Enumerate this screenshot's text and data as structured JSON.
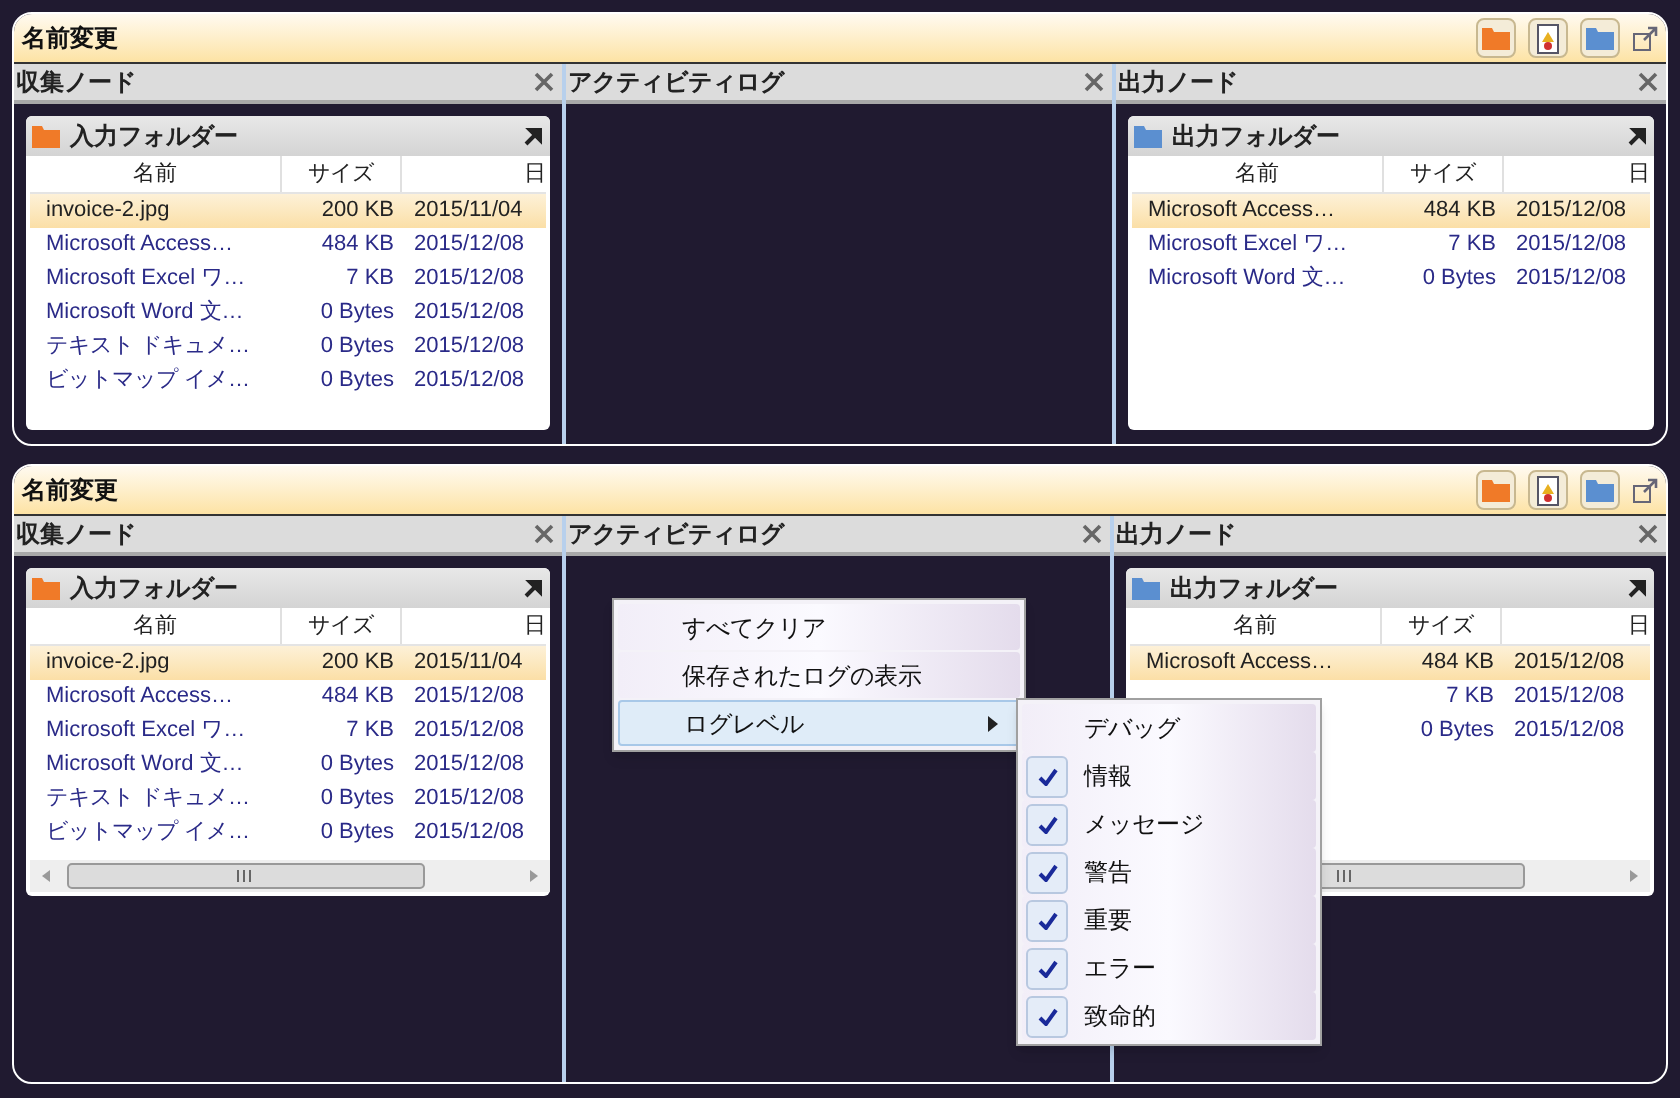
{
  "windows": [
    {
      "title": "名前変更",
      "panes": [
        {
          "kind": "folder",
          "header": "収集ノード",
          "folder": {
            "title": "入力フォルダー",
            "color": "#f07a28",
            "scrollbar": false,
            "columns": [
              "名前",
              "サイズ",
              "日"
            ],
            "rows": [
              {
                "name": "invoice-2.jpg",
                "size": "200 KB",
                "date": "2015/11/04",
                "selected": true
              },
              {
                "name": "Microsoft Access…",
                "size": "484 KB",
                "date": "2015/12/08",
                "selected": false
              },
              {
                "name": "Microsoft Excel ワ…",
                "size": "7 KB",
                "date": "2015/12/08",
                "selected": false
              },
              {
                "name": "Microsoft Word 文…",
                "size": "0 Bytes",
                "date": "2015/12/08",
                "selected": false
              },
              {
                "name": "テキスト ドキュメ…",
                "size": "0 Bytes",
                "date": "2015/12/08",
                "selected": false
              },
              {
                "name": "ビットマップ イメ…",
                "size": "0 Bytes",
                "date": "2015/12/08",
                "selected": false
              }
            ]
          }
        },
        {
          "kind": "log",
          "header": "アクティビティログ"
        },
        {
          "kind": "folder",
          "header": "出力ノード",
          "folder": {
            "title": "出力フォルダー",
            "color": "#5b8fd0",
            "scrollbar": false,
            "columns": [
              "名前",
              "サイズ",
              "日"
            ],
            "rows": [
              {
                "name": "Microsoft Access…",
                "size": "484 KB",
                "date": "2015/12/08",
                "selected": true
              },
              {
                "name": "Microsoft Excel ワ…",
                "size": "7 KB",
                "date": "2015/12/08",
                "selected": false
              },
              {
                "name": "Microsoft Word 文…",
                "size": "0 Bytes",
                "date": "2015/12/08",
                "selected": false
              }
            ]
          }
        }
      ]
    },
    {
      "title": "名前変更",
      "panes": [
        {
          "kind": "folder",
          "header": "収集ノード",
          "folder": {
            "title": "入力フォルダー",
            "color": "#f07a28",
            "scrollbar": true,
            "columns": [
              "名前",
              "サイズ",
              "日"
            ],
            "rows": [
              {
                "name": "invoice-2.jpg",
                "size": "200 KB",
                "date": "2015/11/04",
                "selected": true
              },
              {
                "name": "Microsoft Access…",
                "size": "484 KB",
                "date": "2015/12/08",
                "selected": false
              },
              {
                "name": "Microsoft Excel ワ…",
                "size": "7 KB",
                "date": "2015/12/08",
                "selected": false
              },
              {
                "name": "Microsoft Word 文…",
                "size": "0 Bytes",
                "date": "2015/12/08",
                "selected": false
              },
              {
                "name": "テキスト ドキュメ…",
                "size": "0 Bytes",
                "date": "2015/12/08",
                "selected": false
              },
              {
                "name": "ビットマップ イメ…",
                "size": "0 Bytes",
                "date": "2015/12/08",
                "selected": false
              }
            ]
          }
        },
        {
          "kind": "log",
          "header": "アクティビティログ"
        },
        {
          "kind": "folder",
          "header": "出力ノード",
          "folder": {
            "title": "出力フォルダー",
            "color": "#5b8fd0",
            "scrollbar": true,
            "columns": [
              "名前",
              "サイズ",
              "日"
            ],
            "rows": [
              {
                "name": "Microsoft Access…",
                "size": "484 KB",
                "date": "2015/12/08",
                "selected": true
              },
              {
                "size": "7 KB",
                "date": "2015/12/08",
                "selected": false
              },
              {
                "size": "0 Bytes",
                "date": "2015/12/08",
                "selected": false
              }
            ]
          }
        }
      ]
    }
  ],
  "context_menu": {
    "items": [
      {
        "label": "すべてクリア",
        "kind": "action",
        "selected": false
      },
      {
        "label": "保存されたログの表示",
        "kind": "action",
        "selected": false
      },
      {
        "label": "ログレベル",
        "kind": "submenu",
        "selected": true
      }
    ],
    "submenu": [
      {
        "label": "デバッグ",
        "checked": false
      },
      {
        "label": "情報",
        "checked": true
      },
      {
        "label": "メッセージ",
        "checked": true
      },
      {
        "label": "警告",
        "checked": true
      },
      {
        "label": "重要",
        "checked": true
      },
      {
        "label": "エラー",
        "checked": true
      },
      {
        "label": "致命的",
        "checked": true
      }
    ]
  }
}
